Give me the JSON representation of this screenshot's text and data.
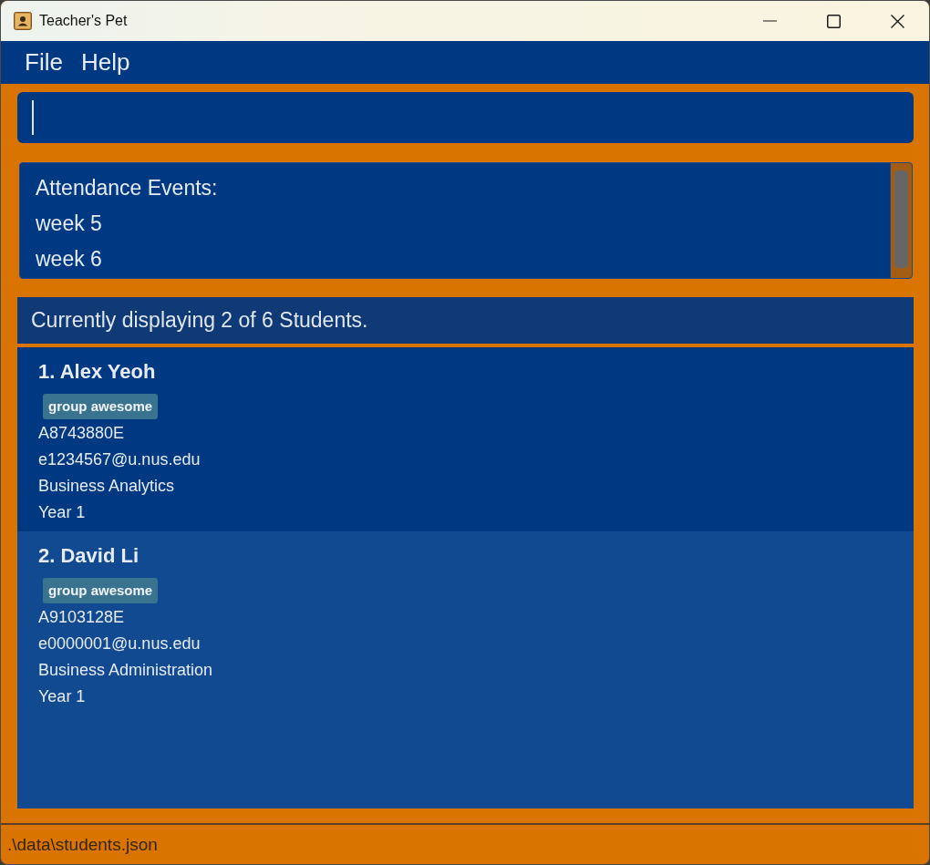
{
  "window": {
    "title": "Teacher's Pet"
  },
  "menu": [
    "File",
    "Help"
  ],
  "command_box": {
    "focused": true
  },
  "attendance": {
    "heading": "Attendance Events:",
    "events": [
      "week 5",
      "week 6"
    ]
  },
  "result": "Currently displaying 2 of 6 Students.",
  "students": [
    {
      "heading": "1. Alex Yeoh",
      "tags": [
        "group awesome"
      ],
      "student_id": "A8743880E",
      "email": "e1234567@u.nus.edu",
      "major": "Business Analytics",
      "year": "Year 1"
    },
    {
      "heading": "2. David Li",
      "tags": [
        "group awesome"
      ],
      "student_id": "A9103128E",
      "email": "e0000001@u.nus.edu",
      "major": "Business Administration",
      "year": "Year 1"
    }
  ],
  "status_bar": {
    "path": ".\\data\\students.json"
  }
}
